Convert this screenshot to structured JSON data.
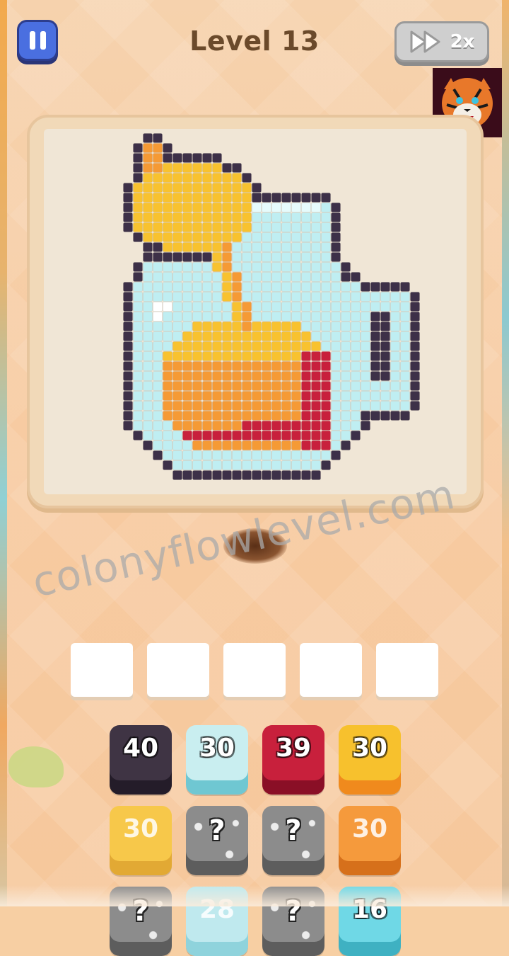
{
  "header": {
    "level_title": "Level 13",
    "speed_label": "2x"
  },
  "watermark_text": "colonyflowlevel.com",
  "slots_count": 5,
  "tiles": [
    {
      "label": "40",
      "color": "#3f3444",
      "shadow": "#241c29",
      "hidden": false
    },
    {
      "label": "30",
      "color": "#c9eef0",
      "shadow": "#6fc7d2",
      "hidden": false
    },
    {
      "label": "39",
      "color": "#c8203c",
      "shadow": "#8a0f26",
      "hidden": false
    },
    {
      "label": "30",
      "color": "#f7c12d",
      "shadow": "#f08a1d",
      "hidden": false
    },
    {
      "label": "30",
      "color": "#f7c84a",
      "shadow": "#e2a934",
      "hidden": false,
      "faded": true
    },
    {
      "label": "?",
      "color": "#8c8c8c",
      "shadow": "#5d5d5d",
      "hidden": true
    },
    {
      "label": "?",
      "color": "#8c8c8c",
      "shadow": "#5d5d5d",
      "hidden": true
    },
    {
      "label": "30",
      "color": "#f59a3c",
      "shadow": "#d6701b",
      "hidden": false,
      "faded": true
    },
    {
      "label": "?",
      "color": "#8c8c8c",
      "shadow": "#5d5d5d",
      "hidden": true
    },
    {
      "label": "28",
      "color": "#bfe9ee",
      "shadow": "#8fd3dc",
      "hidden": false,
      "faded": true
    },
    {
      "label": "?",
      "color": "#8c8c8c",
      "shadow": "#5d5d5d",
      "hidden": true
    },
    {
      "label": "16",
      "color": "#6fd8e6",
      "shadow": "#3fb1c2",
      "hidden": false
    }
  ],
  "colors": {
    "outline": "#3d3048",
    "glass": "#bfeef2",
    "glass_light": "#e6fbfc",
    "orange": "#f59a35",
    "yellow": "#f8c22f",
    "red": "#c8203c",
    "white": "#ffffff"
  },
  "icons": {
    "pause": "pause-icon",
    "speed": "fast-forward-icon",
    "avatar": "tiger-avatar-icon"
  }
}
